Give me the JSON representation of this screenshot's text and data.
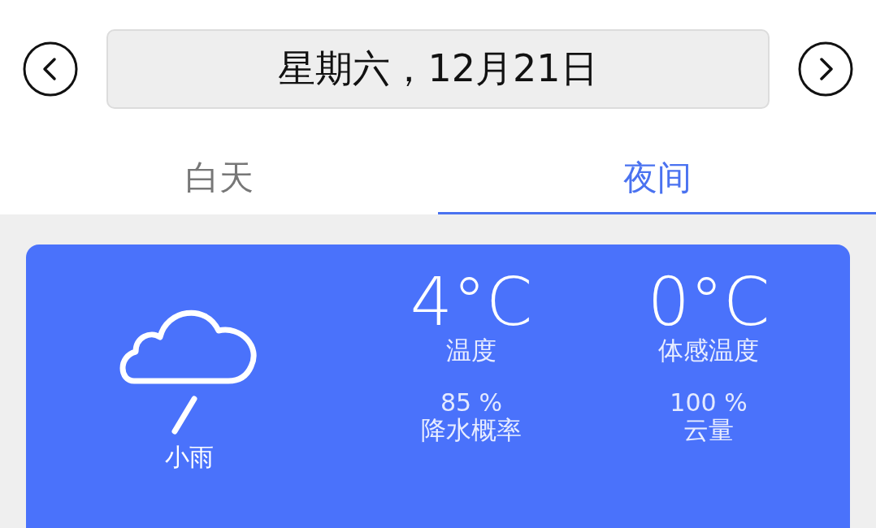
{
  "date": "星期六，12月21日",
  "tabs": [
    {
      "label": "白天",
      "selected": false
    },
    {
      "label": "夜间",
      "selected": true
    }
  ],
  "forecast": {
    "condition": "小雨",
    "stats": [
      {
        "kind": "large",
        "value": "4°C",
        "label": "温度"
      },
      {
        "kind": "large",
        "value": "0°C",
        "label": "体感温度"
      },
      {
        "kind": "small",
        "value": "85 %",
        "label": "降水概率"
      },
      {
        "kind": "small",
        "value": "100 %",
        "label": "云量"
      }
    ]
  }
}
